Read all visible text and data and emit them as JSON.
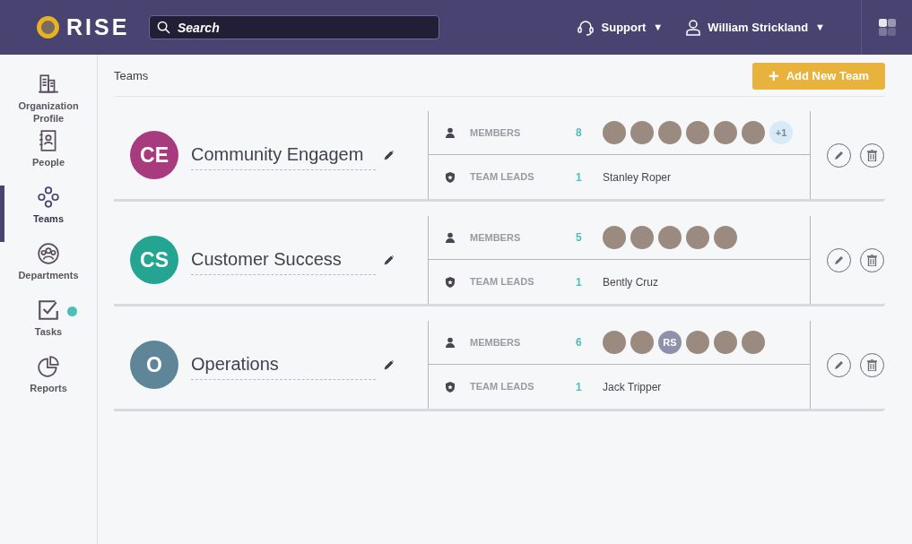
{
  "header": {
    "logo": "RISE",
    "search": {
      "placeholder": "Search"
    },
    "support": "Support",
    "support_caret": "▼",
    "user": "William Strickland",
    "user_caret": "▼"
  },
  "sidebar": {
    "items": [
      {
        "label": "Organization Profile",
        "selected": false,
        "badge": false
      },
      {
        "label": "People",
        "selected": false,
        "badge": false
      },
      {
        "label": "Teams",
        "selected": true,
        "badge": false
      },
      {
        "label": "Departments",
        "selected": false,
        "badge": false
      },
      {
        "label": "Tasks",
        "selected": false,
        "badge": true
      },
      {
        "label": "Reports",
        "selected": false,
        "badge": false
      }
    ]
  },
  "page": {
    "title": "Teams",
    "add_button": "Add New Team",
    "add_icon": "+"
  },
  "teams": [
    {
      "initials": "CE",
      "color": "#a83a7e",
      "name": "Community Engagem",
      "members_label": "MEMBERS",
      "members_count": "8",
      "members": [
        {
          "kind": "photo"
        },
        {
          "kind": "photo"
        },
        {
          "kind": "photo"
        },
        {
          "kind": "photo"
        },
        {
          "kind": "photo"
        },
        {
          "kind": "photo"
        },
        {
          "kind": "more",
          "text": "+1"
        }
      ],
      "leads_label": "TEAM LEADS",
      "leads_count": "1",
      "leads": "Stanley Roper"
    },
    {
      "initials": "CS",
      "color": "#23a591",
      "name": "Customer Success",
      "members_label": "MEMBERS",
      "members_count": "5",
      "members": [
        {
          "kind": "photo"
        },
        {
          "kind": "photo"
        },
        {
          "kind": "photo"
        },
        {
          "kind": "photo"
        },
        {
          "kind": "photo"
        }
      ],
      "leads_label": "TEAM LEADS",
      "leads_count": "1",
      "leads": "Bently Cruz"
    },
    {
      "initials": "O",
      "color": "#5e8598",
      "name": "Operations",
      "members_label": "MEMBERS",
      "members_count": "6",
      "members": [
        {
          "kind": "photo"
        },
        {
          "kind": "photo"
        },
        {
          "kind": "initials",
          "text": "RS"
        },
        {
          "kind": "photo"
        },
        {
          "kind": "photo"
        },
        {
          "kind": "photo"
        }
      ],
      "leads_label": "TEAM LEADS",
      "leads_count": "1",
      "leads": "Jack Tripper"
    }
  ]
}
